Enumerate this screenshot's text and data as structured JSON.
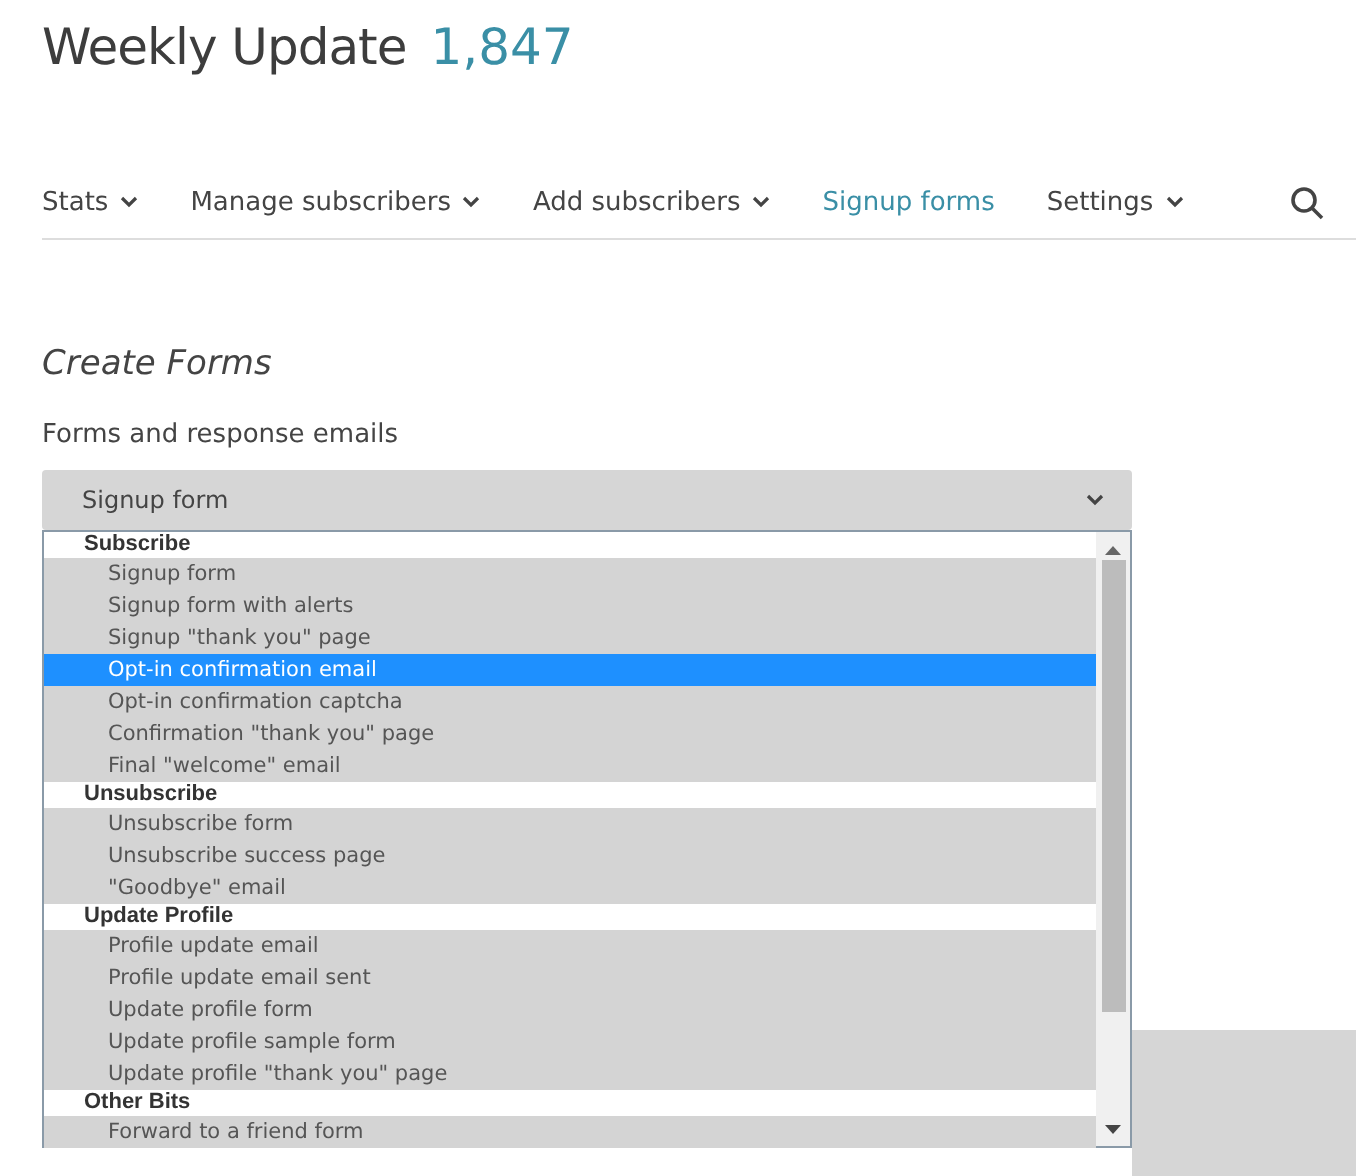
{
  "header": {
    "title": "Weekly Update",
    "count": "1,847"
  },
  "nav": [
    {
      "label": "Stats",
      "dropdown": true,
      "selected": false
    },
    {
      "label": "Manage subscribers",
      "dropdown": true,
      "selected": false
    },
    {
      "label": "Add subscribers",
      "dropdown": true,
      "selected": false
    },
    {
      "label": "Signup forms",
      "dropdown": false,
      "selected": true
    },
    {
      "label": "Settings",
      "dropdown": true,
      "selected": false
    }
  ],
  "section": {
    "title": "Create Forms",
    "field_label": "Forms and response emails"
  },
  "select": {
    "value": "Signup form",
    "expanded": true,
    "groups": [
      {
        "label": "Subscribe",
        "options": [
          {
            "label": "Signup form",
            "selected": false
          },
          {
            "label": "Signup form with alerts",
            "selected": false
          },
          {
            "label": "Signup \"thank you\" page",
            "selected": false
          },
          {
            "label": "Opt-in confirmation email",
            "selected": true
          },
          {
            "label": "Opt-in confirmation captcha",
            "selected": false
          },
          {
            "label": "Confirmation \"thank you\" page",
            "selected": false
          },
          {
            "label": "Final \"welcome\" email",
            "selected": false
          }
        ]
      },
      {
        "label": "Unsubscribe",
        "options": [
          {
            "label": "Unsubscribe form",
            "selected": false
          },
          {
            "label": "Unsubscribe success page",
            "selected": false
          },
          {
            "label": "\"Goodbye\" email",
            "selected": false
          }
        ]
      },
      {
        "label": "Update Profile",
        "options": [
          {
            "label": "Profile update email",
            "selected": false
          },
          {
            "label": "Profile update email sent",
            "selected": false
          },
          {
            "label": "Update profile form",
            "selected": false
          },
          {
            "label": "Update profile sample form",
            "selected": false
          },
          {
            "label": "Update profile \"thank you\" page",
            "selected": false
          }
        ]
      },
      {
        "label": "Other Bits",
        "options": [
          {
            "label": "Forward to a friend form",
            "selected": false
          }
        ]
      }
    ]
  }
}
